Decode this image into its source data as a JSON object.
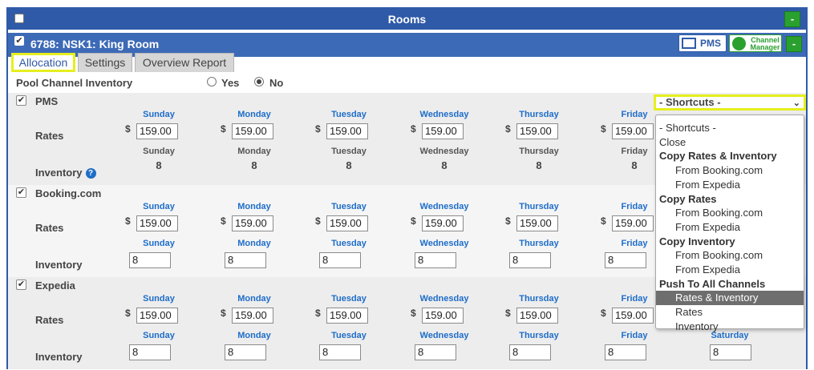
{
  "header": {
    "title": "Rooms",
    "collapse_label": "-"
  },
  "room": {
    "title": "6788: NSK1: King Room",
    "pms_label": "PMS",
    "channel_manager_label": "Channel Manager",
    "collapse_label": "-"
  },
  "tabs": [
    "Allocation",
    "Settings",
    "Overview Report"
  ],
  "pool": {
    "label": "Pool Channel Inventory",
    "yes": "Yes",
    "no": "No",
    "selected": "No"
  },
  "days": [
    "Sunday",
    "Monday",
    "Tuesday",
    "Wednesday",
    "Thursday",
    "Friday"
  ],
  "saturday": "Saturday",
  "labels": {
    "rates": "Rates",
    "inventory": "Inventory",
    "currency": "$",
    "help": "?"
  },
  "channels": [
    {
      "name": "PMS",
      "rates": [
        "159.00",
        "159.00",
        "159.00",
        "159.00",
        "159.00",
        "159.00"
      ],
      "inventory": [
        "8",
        "8",
        "8",
        "8",
        "8",
        "8"
      ],
      "inventory_editable": false
    },
    {
      "name": "Booking.com",
      "rates": [
        "159.00",
        "159.00",
        "159.00",
        "159.00",
        "159.00",
        "159.00"
      ],
      "inventory": [
        "8",
        "8",
        "8",
        "8",
        "8",
        "8"
      ],
      "inventory_editable": true
    },
    {
      "name": "Expedia",
      "rates": [
        "159.00",
        "159.00",
        "159.00",
        "159.00",
        "159.00",
        "159.00"
      ],
      "inventory": [
        "8",
        "8",
        "8",
        "8",
        "8",
        "8"
      ],
      "inventory_editable": true,
      "saturday_inventory": "8"
    }
  ],
  "shortcuts": {
    "selected": "- Shortcuts -",
    "options": [
      {
        "label": "- Shortcuts -",
        "kind": "plain"
      },
      {
        "label": "Close",
        "kind": "plain"
      },
      {
        "label": "Copy Rates & Inventory",
        "kind": "group"
      },
      {
        "label": "From Booking.com",
        "kind": "option"
      },
      {
        "label": "From Expedia",
        "kind": "option"
      },
      {
        "label": "Copy Rates",
        "kind": "group"
      },
      {
        "label": "From Booking.com",
        "kind": "option"
      },
      {
        "label": "From Expedia",
        "kind": "option"
      },
      {
        "label": "Copy Inventory",
        "kind": "group"
      },
      {
        "label": "From Booking.com",
        "kind": "option"
      },
      {
        "label": "From Expedia",
        "kind": "option"
      },
      {
        "label": "Push To All Channels",
        "kind": "group"
      },
      {
        "label": "Rates & Inventory",
        "kind": "option",
        "highlighted": true
      },
      {
        "label": "Rates",
        "kind": "option"
      },
      {
        "label": "Inventory",
        "kind": "option"
      }
    ]
  },
  "colors": {
    "primary": "#2f5aa8",
    "accent": "#e6ef1e",
    "green": "#2aa12f",
    "link": "#1e6dc9"
  }
}
